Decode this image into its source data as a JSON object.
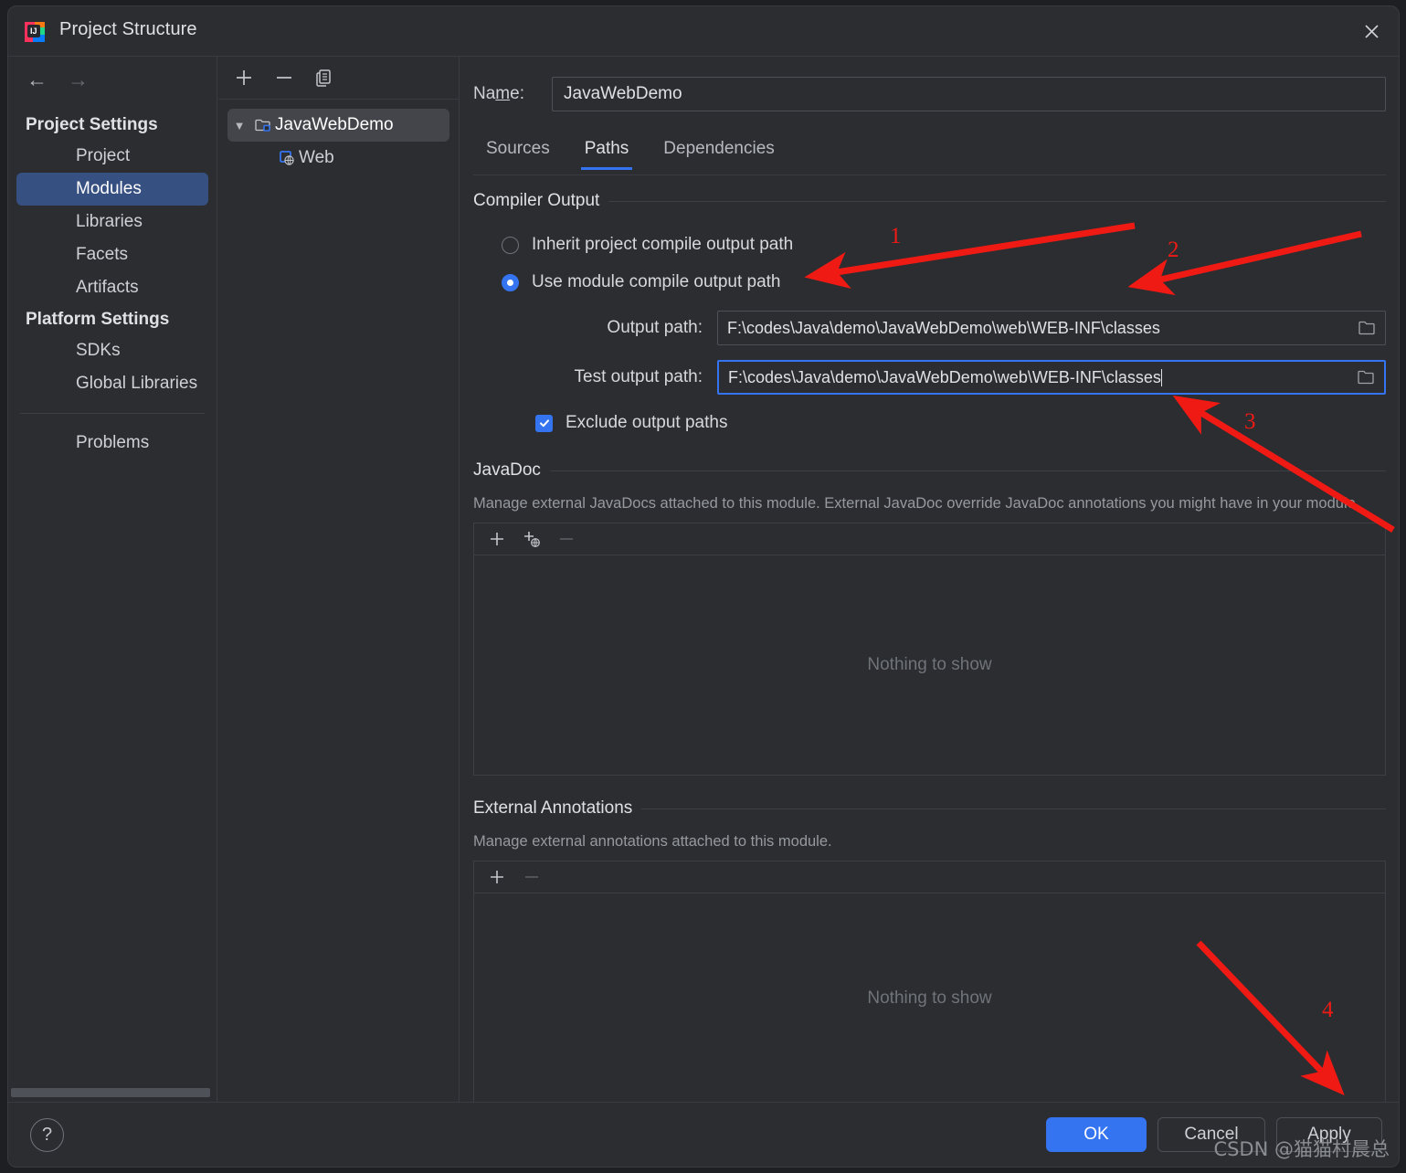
{
  "window": {
    "title": "Project Structure",
    "app_icon": "intellij-idea-icon",
    "close_icon": "close-icon"
  },
  "sidebar": {
    "back_icon": "arrow-left-icon",
    "forward_icon": "arrow-right-icon",
    "groups": [
      {
        "label": "Project Settings",
        "items": [
          {
            "label": "Project",
            "selected": false
          },
          {
            "label": "Modules",
            "selected": true
          },
          {
            "label": "Libraries",
            "selected": false
          },
          {
            "label": "Facets",
            "selected": false
          },
          {
            "label": "Artifacts",
            "selected": false
          }
        ]
      },
      {
        "label": "Platform Settings",
        "items": [
          {
            "label": "SDKs",
            "selected": false
          },
          {
            "label": "Global Libraries",
            "selected": false
          }
        ]
      }
    ],
    "extra_items": [
      {
        "label": "Problems",
        "selected": false
      }
    ]
  },
  "tree_panel": {
    "toolbar": [
      {
        "name": "add-module-button",
        "icon": "plus-icon"
      },
      {
        "name": "remove-module-button",
        "icon": "minus-icon"
      },
      {
        "name": "copy-module-button",
        "icon": "copy-icon"
      }
    ],
    "nodes": [
      {
        "label": "JavaWebDemo",
        "icon": "module-folder-icon",
        "selected": true,
        "expanded": true,
        "depth": 0
      },
      {
        "label": "Web",
        "icon": "web-facet-icon",
        "selected": false,
        "depth": 1
      }
    ]
  },
  "module": {
    "name_label": "Na",
    "name_label_mnemonic": "m",
    "name_label_rest": "e:",
    "name_value": "JavaWebDemo",
    "tabs": [
      {
        "label": "Sources",
        "active": false
      },
      {
        "label": "Paths",
        "active": true
      },
      {
        "label": "Dependencies",
        "active": false
      }
    ]
  },
  "compiler_output": {
    "title": "Compiler Output",
    "options": [
      {
        "label": "Inherit project compile output path",
        "selected": false
      },
      {
        "label": "Use module compile output path",
        "selected": true
      }
    ],
    "output_path": {
      "label": "Output path:",
      "value": "F:\\codes\\Java\\demo\\JavaWebDemo\\web\\WEB-INF\\classes",
      "focused": false,
      "browse_icon": "folder-icon"
    },
    "test_output_path": {
      "label": "Test output path:",
      "value": "F:\\codes\\Java\\demo\\JavaWebDemo\\web\\WEB-INF\\classes",
      "focused": true,
      "browse_icon": "folder-icon"
    },
    "exclude_checkbox": {
      "label": "Exclude output paths",
      "checked": true
    }
  },
  "javadoc": {
    "title": "JavaDoc",
    "description": "Manage external JavaDocs attached to this module. External JavaDoc override JavaDoc annotations you might have in your module.",
    "toolbar": [
      {
        "name": "add-javadoc-path-button",
        "icon": "plus-icon",
        "enabled": true
      },
      {
        "name": "add-javadoc-url-button",
        "icon": "plus-globe-icon",
        "enabled": true
      },
      {
        "name": "remove-javadoc-button",
        "icon": "minus-icon",
        "enabled": false
      }
    ],
    "empty_text": "Nothing to show"
  },
  "external_annotations": {
    "title": "External Annotations",
    "description": "Manage external annotations attached to this module.",
    "toolbar": [
      {
        "name": "add-annotation-path-button",
        "icon": "plus-icon",
        "enabled": true
      },
      {
        "name": "remove-annotation-button",
        "icon": "minus-icon",
        "enabled": false
      }
    ],
    "empty_text": "Nothing to show"
  },
  "footer": {
    "help_label": "?",
    "ok_label": "OK",
    "cancel_label": "Cancel",
    "apply_label": "Apply"
  },
  "annotations": {
    "color": "#f01a15",
    "numbers": [
      {
        "text": "1"
      },
      {
        "text": "2"
      },
      {
        "text": "3"
      },
      {
        "text": "4"
      }
    ]
  },
  "watermark": {
    "text": "CSDN @猫猫村晨总"
  },
  "colors": {
    "background": "#2b2d30",
    "accent": "#3574f0",
    "selection": "#375082",
    "annotation_red": "#f01a15"
  }
}
